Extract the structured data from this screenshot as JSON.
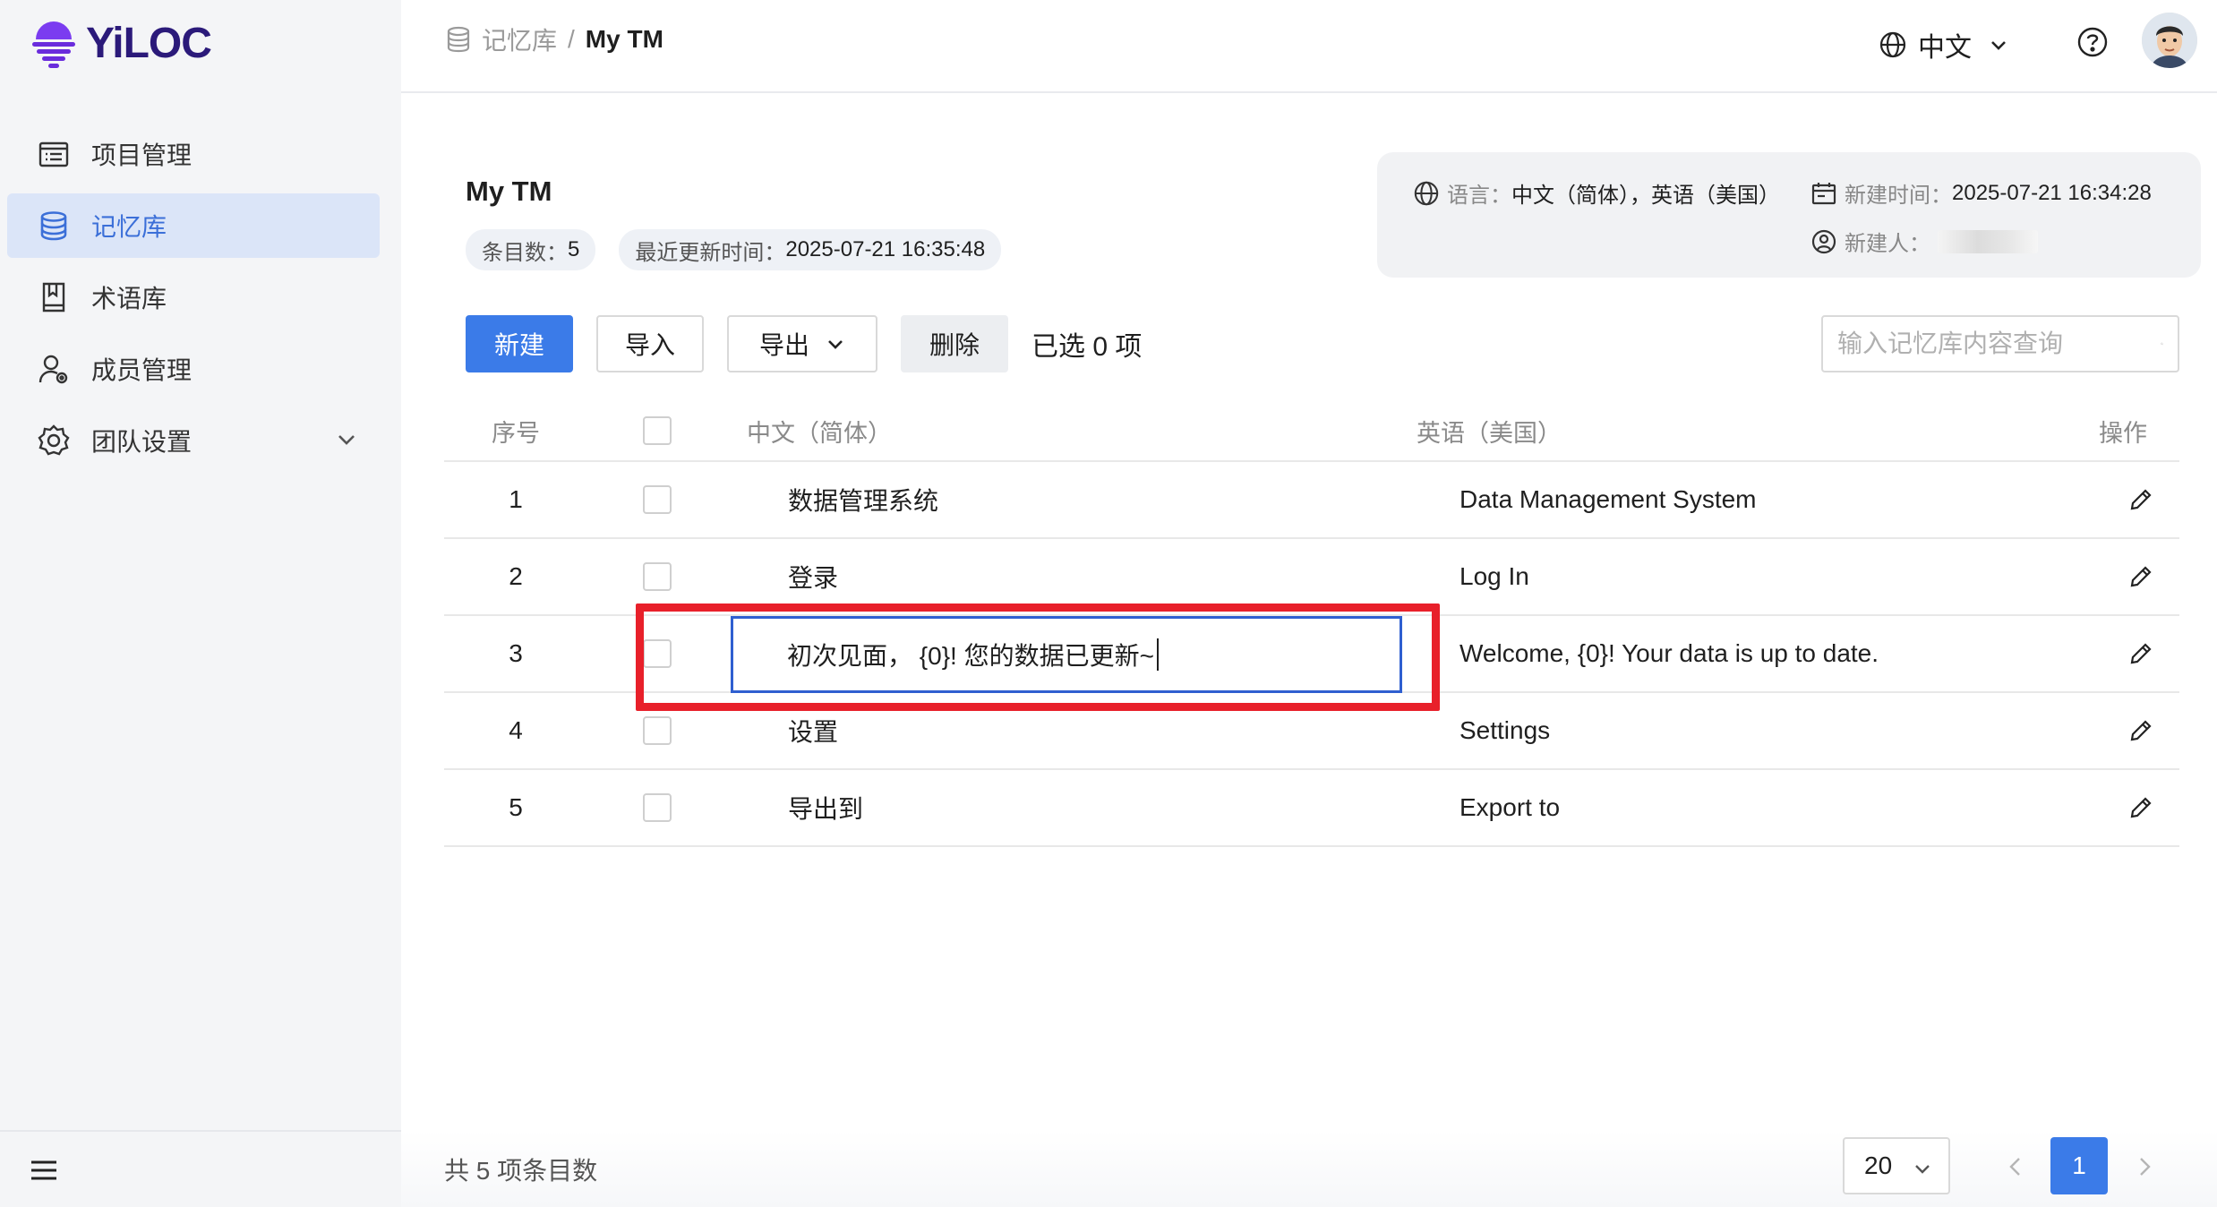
{
  "brand": {
    "name": "YiLOC",
    "color": "#6a2cdc"
  },
  "sidebar": {
    "items": [
      {
        "label": "项目管理",
        "icon": "list-icon",
        "active": false
      },
      {
        "label": "记忆库",
        "icon": "database-icon",
        "active": true
      },
      {
        "label": "术语库",
        "icon": "book-icon",
        "active": false
      },
      {
        "label": "成员管理",
        "icon": "user-gear-icon",
        "active": false
      },
      {
        "label": "团队设置",
        "icon": "gear-icon",
        "active": false,
        "expandable": true
      }
    ]
  },
  "header": {
    "breadcrumb_parent": "记忆库",
    "breadcrumb_sep": "/",
    "breadcrumb_current": "My TM",
    "language": "中文"
  },
  "tm": {
    "title": "My TM",
    "entries_label": "条目数：",
    "entries_value": "5",
    "updated_label": "最近更新时间：",
    "updated_value": "2025-07-21 16:35:48",
    "lang_label": "语言：",
    "lang_value": "中文（简体），英语（美国）",
    "created_label": "新建时间：",
    "created_value": "2025-07-21 16:34:28",
    "creator_label": "新建人："
  },
  "toolbar": {
    "new_label": "新建",
    "import_label": "导入",
    "export_label": "导出",
    "delete_label": "删除",
    "selected_text": "已选 0 项",
    "search_placeholder": "输入记忆库内容查询"
  },
  "table": {
    "headers": {
      "num": "序号",
      "zh": "中文（简体）",
      "en": "英语（美国）",
      "op": "操作"
    },
    "rows": [
      {
        "num": "1",
        "zh": "数据管理系统",
        "en": "Data Management System"
      },
      {
        "num": "2",
        "zh": "登录",
        "en": "Log In"
      },
      {
        "num": "3",
        "zh": "初次见面， {0}! 您的数据已更新~",
        "en": "Welcome, {0}! Your data is up to date.",
        "editing": true
      },
      {
        "num": "4",
        "zh": "设置",
        "en": "Settings"
      },
      {
        "num": "5",
        "zh": "导出到",
        "en": "Export to"
      }
    ]
  },
  "footer": {
    "total_text": "共 5 项条目数",
    "page_size": "20",
    "current_page": "1"
  },
  "colors": {
    "primary": "#3b7be8",
    "highlight": "#e8202a",
    "edit_border": "#2f5fd0"
  }
}
